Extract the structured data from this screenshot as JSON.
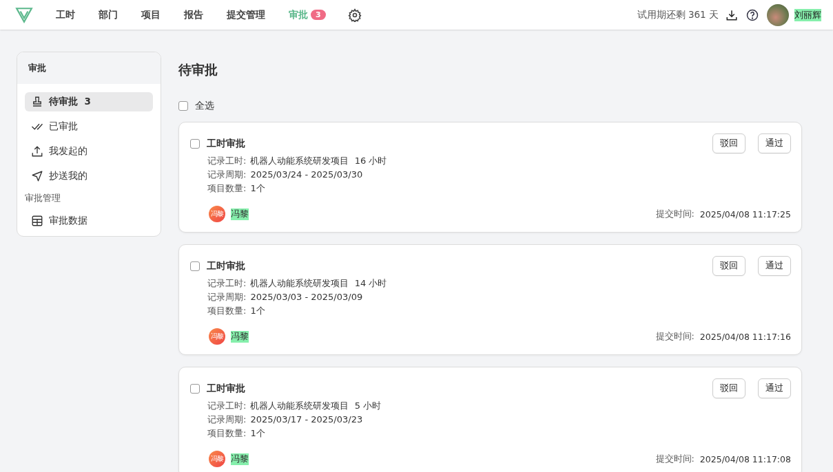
{
  "topbar": {
    "nav": [
      {
        "label": "工时",
        "selected": false
      },
      {
        "label": "部门",
        "selected": false
      },
      {
        "label": "项目",
        "selected": false
      },
      {
        "label": "报告",
        "selected": false
      },
      {
        "label": "提交管理",
        "selected": false
      },
      {
        "label": "审批",
        "selected": true,
        "badge": "3"
      }
    ],
    "trial": "试用期还剩 361 天",
    "user": "刘丽辉"
  },
  "sidebar": {
    "title": "审批",
    "items": [
      {
        "kind": "stamp",
        "label": "待审批",
        "count": "3",
        "selected": true
      },
      {
        "kind": "check",
        "label": "已审批",
        "selected": false
      },
      {
        "kind": "upload",
        "label": "我发起的",
        "selected": false
      },
      {
        "kind": "send",
        "label": "抄送我的",
        "selected": false
      },
      {
        "kind": "heading",
        "label": "审批管理"
      },
      {
        "kind": "table",
        "label": "审批数据",
        "selected": false
      }
    ]
  },
  "page_title": "待审批",
  "select_all": {
    "label": "全选",
    "checked": false
  },
  "cards": [
    {
      "checked": false,
      "title": "工时审批",
      "details": [
        {
          "label": "记录工时:",
          "value": "机器人动能系统研发项目  16 小时"
        },
        {
          "label": "记录周期:",
          "value": "2025/03/24 - 2025/03/30"
        },
        {
          "label": "项目数量:",
          "value": "1个"
        }
      ],
      "avatar": "冯黎",
      "submitter": "冯黎",
      "time_label": "提交时间:",
      "time": "2025/04/08 11:17:25",
      "buttons": [
        "驳回",
        "通过"
      ]
    },
    {
      "checked": false,
      "title": "工时审批",
      "details": [
        {
          "label": "记录工时:",
          "value": "机器人动能系统研发项目  14 小时"
        },
        {
          "label": "记录周期:",
          "value": "2025/03/03 - 2025/03/09"
        },
        {
          "label": "项目数量:",
          "value": "1个"
        }
      ],
      "avatar": "冯黎",
      "submitter": "冯黎",
      "time_label": "提交时间:",
      "time": "2025/04/08 11:17:16",
      "buttons": [
        "驳回",
        "通过"
      ]
    },
    {
      "checked": false,
      "title": "工时审批",
      "details": [
        {
          "label": "记录工时:",
          "value": "机器人动能系统研发项目  5 小时"
        },
        {
          "label": "记录周期:",
          "value": "2025/03/17 - 2025/03/23"
        },
        {
          "label": "项目数量:",
          "value": "1个"
        }
      ],
      "avatar": "冯黎",
      "submitter": "冯黎",
      "time_label": "提交时间:",
      "time": "2025/04/08 11:17:08",
      "buttons": [
        "驳回",
        "通过"
      ]
    }
  ]
}
